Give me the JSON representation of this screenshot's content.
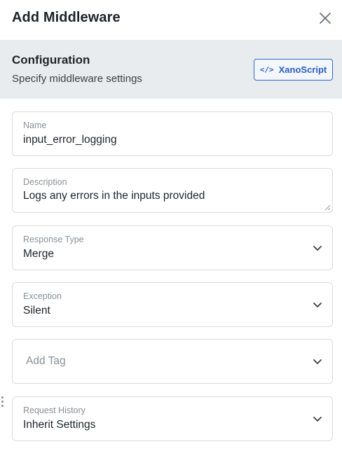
{
  "panel": {
    "title": "Add Middleware",
    "close_icon": "close-icon"
  },
  "config": {
    "heading": "Configuration",
    "subheading": "Specify middleware settings",
    "xanoscript_label": "XanoScript",
    "xanoscript_icon": "code-icon"
  },
  "fields": {
    "name": {
      "label": "Name",
      "value": "input_error_logging"
    },
    "description": {
      "label": "Description",
      "value": "Logs any errors in the inputs provided"
    },
    "response_type": {
      "label": "Response Type",
      "value": "Merge"
    },
    "exception": {
      "label": "Exception",
      "value": "Silent"
    },
    "tag": {
      "placeholder": "Add Tag"
    },
    "request_history": {
      "label": "Request History",
      "value": "Inherit Settings"
    }
  },
  "colors": {
    "accent": "#2b5fc2",
    "config_background": "#e9ecef",
    "border": "#d9dce0"
  }
}
